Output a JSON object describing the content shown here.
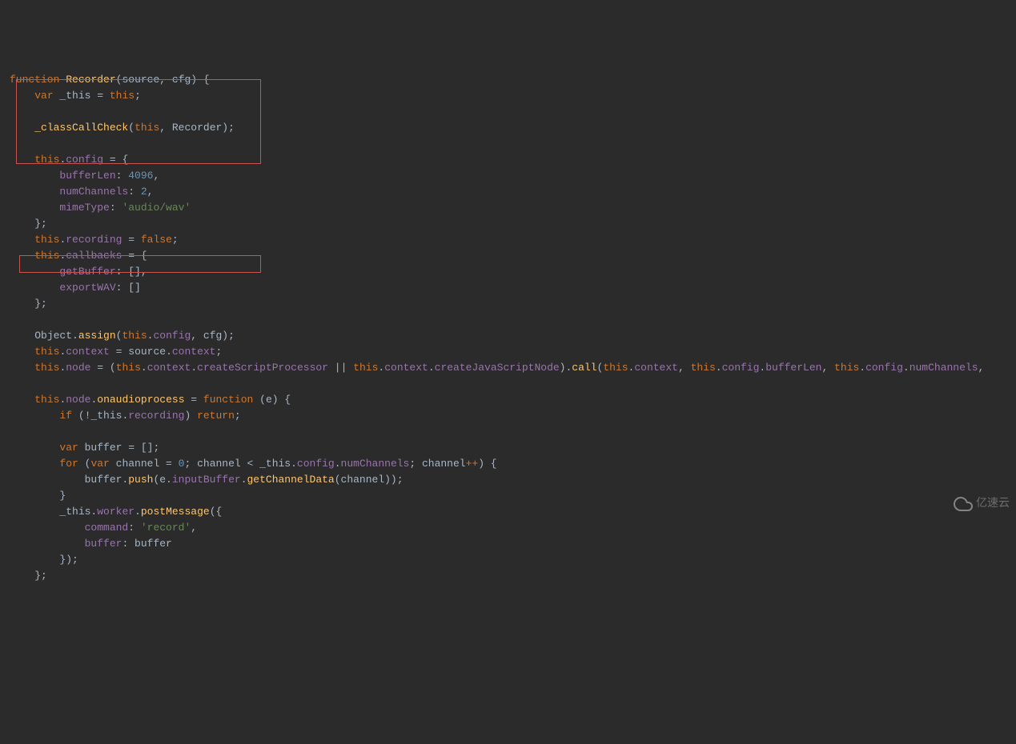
{
  "code": {
    "lines": [
      {
        "indent": 0,
        "tokens": [
          {
            "t": "function",
            "c": "keyword"
          },
          {
            "t": " "
          },
          {
            "t": "Recorder",
            "c": "function-name"
          },
          {
            "t": "("
          },
          {
            "t": "source",
            "c": "param"
          },
          {
            "t": ", "
          },
          {
            "t": "cfg",
            "c": "param"
          },
          {
            "t": ") {"
          }
        ]
      },
      {
        "indent": 1,
        "tokens": [
          {
            "t": "var",
            "c": "keyword"
          },
          {
            "t": " _this = "
          },
          {
            "t": "this",
            "c": "this"
          },
          {
            "t": ";"
          }
        ]
      },
      {
        "indent": 0,
        "tokens": [
          {
            "t": ""
          }
        ]
      },
      {
        "indent": 1,
        "tokens": [
          {
            "t": "_classCallCheck",
            "c": "method"
          },
          {
            "t": "("
          },
          {
            "t": "this",
            "c": "this"
          },
          {
            "t": ", Recorder);"
          }
        ]
      },
      {
        "indent": 0,
        "tokens": [
          {
            "t": ""
          }
        ]
      },
      {
        "indent": 1,
        "tokens": [
          {
            "t": "this",
            "c": "this"
          },
          {
            "t": "."
          },
          {
            "t": "config",
            "c": "property"
          },
          {
            "t": " = {"
          }
        ]
      },
      {
        "indent": 2,
        "tokens": [
          {
            "t": "bufferLen",
            "c": "property"
          },
          {
            "t": ": "
          },
          {
            "t": "4096",
            "c": "number"
          },
          {
            "t": ","
          }
        ]
      },
      {
        "indent": 2,
        "tokens": [
          {
            "t": "numChannels",
            "c": "property"
          },
          {
            "t": ": "
          },
          {
            "t": "2",
            "c": "number"
          },
          {
            "t": ","
          }
        ]
      },
      {
        "indent": 2,
        "tokens": [
          {
            "t": "mimeType",
            "c": "property"
          },
          {
            "t": ": "
          },
          {
            "t": "'audio/wav'",
            "c": "string"
          }
        ]
      },
      {
        "indent": 1,
        "tokens": [
          {
            "t": "};"
          }
        ]
      },
      {
        "indent": 1,
        "tokens": [
          {
            "t": "this",
            "c": "this"
          },
          {
            "t": "."
          },
          {
            "t": "recording",
            "c": "property"
          },
          {
            "t": " = "
          },
          {
            "t": "false",
            "c": "bool"
          },
          {
            "t": ";"
          }
        ]
      },
      {
        "indent": 1,
        "tokens": [
          {
            "t": "this",
            "c": "this"
          },
          {
            "t": "."
          },
          {
            "t": "callbacks",
            "c": "property"
          },
          {
            "t": " = {"
          }
        ]
      },
      {
        "indent": 2,
        "tokens": [
          {
            "t": "getBuffer",
            "c": "property"
          },
          {
            "t": ": [],"
          }
        ]
      },
      {
        "indent": 2,
        "tokens": [
          {
            "t": "exportWAV",
            "c": "property"
          },
          {
            "t": ": []"
          }
        ]
      },
      {
        "indent": 1,
        "tokens": [
          {
            "t": "};"
          }
        ]
      },
      {
        "indent": 0,
        "tokens": [
          {
            "t": ""
          }
        ]
      },
      {
        "indent": 1,
        "tokens": [
          {
            "t": "Object."
          },
          {
            "t": "assign",
            "c": "method"
          },
          {
            "t": "("
          },
          {
            "t": "this",
            "c": "this"
          },
          {
            "t": "."
          },
          {
            "t": "config",
            "c": "property"
          },
          {
            "t": ", cfg);"
          }
        ]
      },
      {
        "indent": 1,
        "tokens": [
          {
            "t": "this",
            "c": "this"
          },
          {
            "t": "."
          },
          {
            "t": "context",
            "c": "property"
          },
          {
            "t": " = source."
          },
          {
            "t": "context",
            "c": "property"
          },
          {
            "t": ";"
          }
        ]
      },
      {
        "indent": 1,
        "tokens": [
          {
            "t": "this",
            "c": "this"
          },
          {
            "t": "."
          },
          {
            "t": "node",
            "c": "property"
          },
          {
            "t": " = ("
          },
          {
            "t": "this",
            "c": "this"
          },
          {
            "t": "."
          },
          {
            "t": "context",
            "c": "property"
          },
          {
            "t": "."
          },
          {
            "t": "createScriptProcessor",
            "c": "property"
          },
          {
            "t": " || "
          },
          {
            "t": "this",
            "c": "this"
          },
          {
            "t": "."
          },
          {
            "t": "context",
            "c": "property"
          },
          {
            "t": "."
          },
          {
            "t": "createJavaScriptNode",
            "c": "property"
          },
          {
            "t": ")."
          },
          {
            "t": "call",
            "c": "method"
          },
          {
            "t": "("
          },
          {
            "t": "this",
            "c": "this"
          },
          {
            "t": "."
          },
          {
            "t": "context",
            "c": "property"
          },
          {
            "t": ", "
          },
          {
            "t": "this",
            "c": "this"
          },
          {
            "t": "."
          },
          {
            "t": "config",
            "c": "property"
          },
          {
            "t": "."
          },
          {
            "t": "bufferLen",
            "c": "property"
          },
          {
            "t": ", "
          },
          {
            "t": "this",
            "c": "this"
          },
          {
            "t": "."
          },
          {
            "t": "config",
            "c": "property"
          },
          {
            "t": "."
          },
          {
            "t": "numChannels",
            "c": "property"
          },
          {
            "t": ", "
          }
        ]
      },
      {
        "indent": 0,
        "tokens": [
          {
            "t": ""
          }
        ]
      },
      {
        "indent": 1,
        "tokens": [
          {
            "t": "this",
            "c": "this"
          },
          {
            "t": "."
          },
          {
            "t": "node",
            "c": "property"
          },
          {
            "t": "."
          },
          {
            "t": "onaudioprocess",
            "c": "method"
          },
          {
            "t": " = "
          },
          {
            "t": "function",
            "c": "keyword"
          },
          {
            "t": " ("
          },
          {
            "t": "e",
            "c": "param"
          },
          {
            "t": ") {"
          }
        ]
      },
      {
        "indent": 2,
        "tokens": [
          {
            "t": "if",
            "c": "keyword"
          },
          {
            "t": " (!_this."
          },
          {
            "t": "recording",
            "c": "property"
          },
          {
            "t": ") "
          },
          {
            "t": "return",
            "c": "keyword"
          },
          {
            "t": ";"
          }
        ]
      },
      {
        "indent": 0,
        "tokens": [
          {
            "t": ""
          }
        ]
      },
      {
        "indent": 2,
        "tokens": [
          {
            "t": "var",
            "c": "keyword"
          },
          {
            "t": " buffer = [];"
          }
        ]
      },
      {
        "indent": 2,
        "tokens": [
          {
            "t": "for",
            "c": "keyword"
          },
          {
            "t": " ("
          },
          {
            "t": "var",
            "c": "keyword"
          },
          {
            "t": " channel = "
          },
          {
            "t": "0",
            "c": "number"
          },
          {
            "t": "; channel < _this."
          },
          {
            "t": "config",
            "c": "property"
          },
          {
            "t": "."
          },
          {
            "t": "numChannels",
            "c": "property"
          },
          {
            "t": "; channel"
          },
          {
            "t": "++",
            "c": "keyword"
          },
          {
            "t": ") {"
          }
        ]
      },
      {
        "indent": 3,
        "tokens": [
          {
            "t": "buffer."
          },
          {
            "t": "push",
            "c": "method"
          },
          {
            "t": "(e."
          },
          {
            "t": "inputBuffer",
            "c": "property"
          },
          {
            "t": "."
          },
          {
            "t": "getChannelData",
            "c": "method"
          },
          {
            "t": "(channel));"
          }
        ]
      },
      {
        "indent": 2,
        "tokens": [
          {
            "t": "}"
          }
        ]
      },
      {
        "indent": 2,
        "tokens": [
          {
            "t": "_this."
          },
          {
            "t": "worker",
            "c": "property"
          },
          {
            "t": "."
          },
          {
            "t": "postMessage",
            "c": "method"
          },
          {
            "t": "({"
          }
        ]
      },
      {
        "indent": 3,
        "tokens": [
          {
            "t": "command",
            "c": "property"
          },
          {
            "t": ": "
          },
          {
            "t": "'record'",
            "c": "string"
          },
          {
            "t": ","
          }
        ]
      },
      {
        "indent": 3,
        "tokens": [
          {
            "t": "buffer",
            "c": "property"
          },
          {
            "t": ": buffer"
          }
        ]
      },
      {
        "indent": 2,
        "tokens": [
          {
            "t": "});"
          }
        ]
      },
      {
        "indent": 1,
        "tokens": [
          {
            "t": "};"
          }
        ]
      }
    ]
  },
  "watermark": "亿速云"
}
